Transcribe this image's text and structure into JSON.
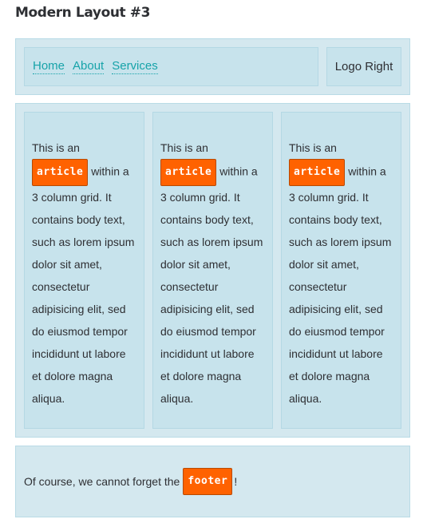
{
  "page": {
    "title": "Modern Layout #3"
  },
  "header": {
    "nav": [
      "Home",
      "About",
      "Services"
    ],
    "logo": "Logo Right"
  },
  "articles": [
    {
      "intro": "This is an",
      "tag": "article",
      "body": "within a 3 column grid. It contains body text, such as lorem ipsum dolor sit amet, consectetur adipisicing elit, sed do eiusmod tempor incididunt ut labore et dolore magna aliqua."
    },
    {
      "intro": "This is an",
      "tag": "article",
      "body": "within a 3 column grid. It contains body text, such as lorem ipsum dolor sit amet, consectetur adipisicing elit, sed do eiusmod tempor incididunt ut labore et dolore magna aliqua."
    },
    {
      "intro": "This is an",
      "tag": "article",
      "body": "within a 3 column grid. It contains body text, such as lorem ipsum dolor sit amet, consectetur adipisicing elit, sed do eiusmod tempor incididunt ut labore et dolore magna aliqua."
    }
  ],
  "footer": {
    "text_before": "Of course, we cannot forget the",
    "tag": "footer",
    "text_after": "!"
  },
  "colors": {
    "tag_background": "#ff6200",
    "link": "#17a3a9",
    "panel_background": "#d4e8ef",
    "box_background": "#c7e3ec"
  }
}
